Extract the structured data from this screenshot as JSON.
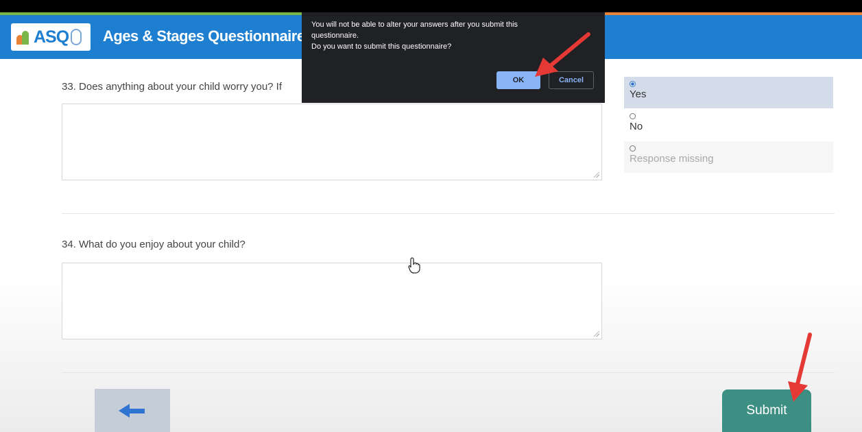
{
  "header": {
    "logo_text": "ASQ",
    "title": "Ages & Stages Questionnaires",
    "title_mark": "®"
  },
  "questions": [
    {
      "label": "33.  Does anything about your child worry you? If",
      "answer": ""
    },
    {
      "label": "34.  What do you enjoy about your child?",
      "answer": ""
    }
  ],
  "radio_options": [
    {
      "label": "Yes",
      "selected": true
    },
    {
      "label": "No",
      "selected": false
    },
    {
      "label": "Response missing",
      "selected": false
    }
  ],
  "dialog": {
    "line1": "You will not be able to alter your answers after you submit this questionnaire.",
    "line2": "Do you want to submit this questionnaire?",
    "ok_label": "OK",
    "cancel_label": "Cancel"
  },
  "footer": {
    "back_icon": "arrow-left-icon",
    "submit_label": "Submit"
  },
  "colors": {
    "header_blue": "#1e7fd1",
    "submit_teal": "#3e8f83",
    "dialog_bg": "#202124",
    "annotation_red": "#e53935"
  }
}
